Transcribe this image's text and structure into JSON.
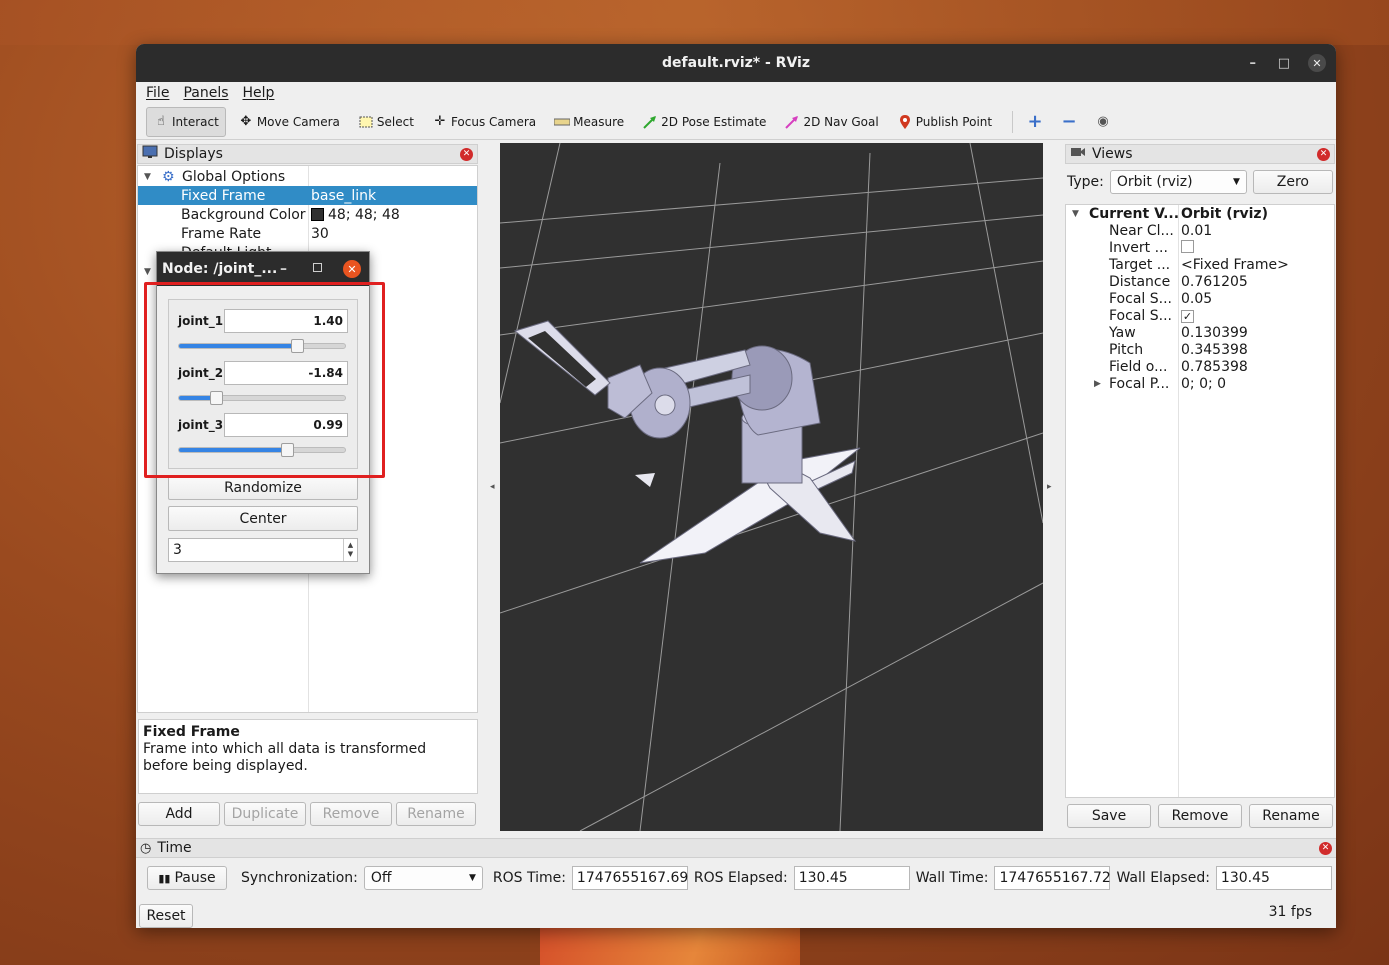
{
  "window": {
    "title": "default.rviz* - RViz",
    "min": "–",
    "max": "□",
    "close": "✕"
  },
  "menu": [
    "File",
    "Panels",
    "Help"
  ],
  "toolbar": {
    "tools": [
      {
        "label": "Interact",
        "icon": "cursor-icon"
      },
      {
        "label": "Move Camera",
        "icon": "move-camera-icon"
      },
      {
        "label": "Select",
        "icon": "select-icon"
      },
      {
        "label": "Focus Camera",
        "icon": "focus-camera-icon"
      },
      {
        "label": "Measure",
        "icon": "ruler-icon"
      },
      {
        "label": "2D Pose Estimate",
        "icon": "green-arrow-icon"
      },
      {
        "label": "2D Nav Goal",
        "icon": "pink-arrow-icon"
      },
      {
        "label": "Publish Point",
        "icon": "map-pin-icon"
      }
    ],
    "plus": "+",
    "minus": "−",
    "eye": "◉"
  },
  "displays": {
    "title": "Displays",
    "global_options": "Global Options",
    "rows": [
      {
        "key": "Fixed Frame",
        "value": "base_link"
      },
      {
        "key": "Background Color",
        "value": "48; 48; 48"
      },
      {
        "key": "Frame Rate",
        "value": "30"
      },
      {
        "key": "Default Light",
        "value": ""
      }
    ],
    "description_title": "Fixed Frame",
    "description_text": "Frame into which all data is transformed before being displayed.",
    "buttons": {
      "add": "Add",
      "duplicate": "Duplicate",
      "remove": "Remove",
      "rename": "Rename"
    }
  },
  "views": {
    "title": "Views",
    "type_label": "Type:",
    "type_value": "Orbit (rviz)",
    "zero": "Zero",
    "current_key": "Current V...",
    "current_value": "Orbit (rviz)",
    "props": [
      {
        "key": "Near Cl...",
        "value": "0.01"
      },
      {
        "key": "Invert ...",
        "value": ""
      },
      {
        "key": "Target ...",
        "value": "<Fixed Frame>"
      },
      {
        "key": "Distance",
        "value": "0.761205"
      },
      {
        "key": "Focal S...",
        "value": "0.05"
      },
      {
        "key": "Focal S...",
        "value": "✓"
      },
      {
        "key": "Yaw",
        "value": "0.130399"
      },
      {
        "key": "Pitch",
        "value": "0.345398"
      },
      {
        "key": "Field o...",
        "value": "0.785398"
      },
      {
        "key": "Focal P...",
        "value": "0; 0; 0"
      }
    ],
    "buttons": {
      "save": "Save",
      "remove": "Remove",
      "rename": "Rename"
    }
  },
  "time": {
    "title": "Time",
    "pause": "Pause",
    "sync_label": "Synchronization:",
    "sync_value": "Off",
    "ros_time_label": "ROS Time:",
    "ros_time": "1747655167.69",
    "ros_elapsed_label": "ROS Elapsed:",
    "ros_elapsed": "130.45",
    "wall_time_label": "Wall Time:",
    "wall_time": "1747655167.72",
    "wall_elapsed_label": "Wall Elapsed:",
    "wall_elapsed": "130.45",
    "reset": "Reset",
    "fps": "31 fps"
  },
  "joint_dialog": {
    "title": "Node: /joint_...",
    "joints": [
      {
        "name": "joint_1",
        "value": "1.40",
        "slider": 0.7
      },
      {
        "name": "joint_2",
        "value": "-1.84",
        "slider": 0.22
      },
      {
        "name": "joint_3",
        "value": "0.99",
        "slider": 0.64
      }
    ],
    "randomize": "Randomize",
    "center": "Center",
    "spin_value": "3"
  },
  "colors": {
    "selection": "#308cc6",
    "viewport": "#303030",
    "highlight": "#e02020",
    "slider": "#3584e4"
  }
}
